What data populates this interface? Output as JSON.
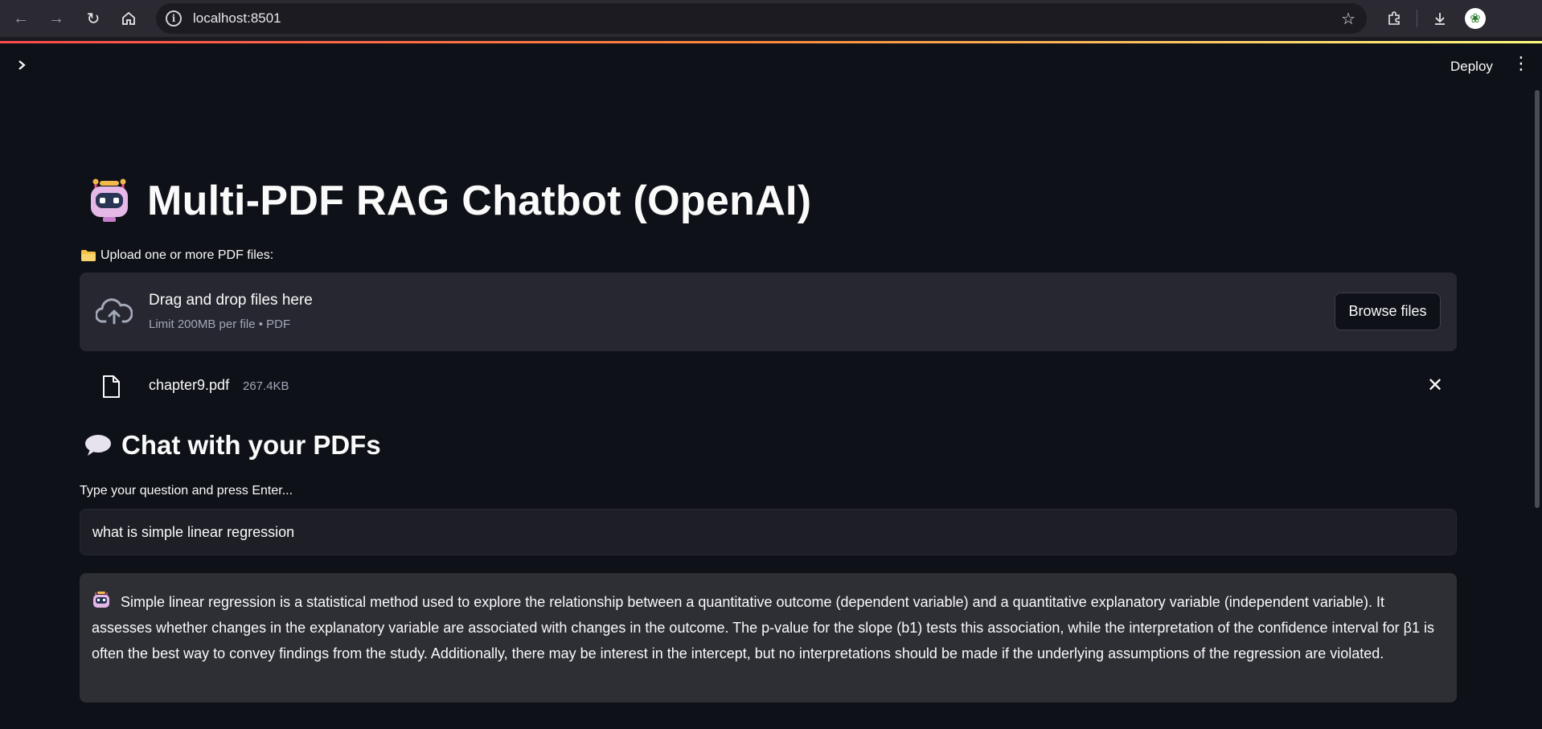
{
  "browser": {
    "url": "localhost:8501",
    "icons": [
      "back-icon",
      "forward-icon",
      "reload-icon",
      "home-icon",
      "site-info-icon",
      "bookmark-star-icon",
      "extensions-icon",
      "downloads-icon",
      "profile-avatar"
    ]
  },
  "header": {
    "deploy_label": "Deploy",
    "menu_icon": "more-vertical-icon",
    "sidebar_toggle_icon": "chevron-right-icon"
  },
  "main": {
    "title": "Multi-PDF RAG Chatbot (OpenAI)",
    "upload_label": "Upload one or more PDF files:",
    "uploader": {
      "drag_text": "Drag and drop files here",
      "limit_text": "Limit 200MB per file • PDF",
      "browse_label": "Browse files"
    },
    "files": [
      {
        "name": "chapter9.pdf",
        "size": "267.4KB"
      }
    ],
    "chat_heading": "Chat with your PDFs",
    "question_label": "Type your question and press Enter...",
    "question_value": "what is simple linear regression",
    "answer": "Simple linear regression is a statistical method used to explore the relationship between a quantitative outcome (dependent variable) and a quantitative explanatory variable (independent variable). It assesses whether changes in the explanatory variable are associated with changes in the outcome. The p-value for the slope (b1) tests this association, while the interpretation of the confidence interval for β1 is often the best way to convey findings from the study. Additionally, there may be interest in the intercept, but no interpretations should be made if the underlying assumptions of the regression are violated."
  },
  "colors": {
    "background": "#0e1117",
    "uploader_bg": "#262730",
    "answer_bg": "#2e2f35",
    "accent_gradient_start": "#ff4b4b",
    "accent_gradient_end": "#fffd80"
  }
}
